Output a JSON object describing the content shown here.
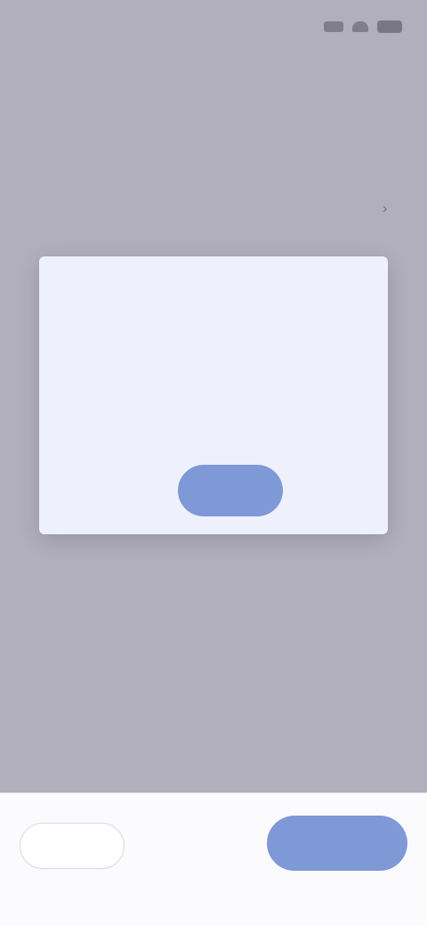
{
  "status_bar": {
    "time": "",
    "icons": [
      "signal-icon",
      "wifi-icon",
      "battery-icon"
    ]
  },
  "header": {
    "title": "",
    "subtitle": ""
  },
  "section": {
    "title": "",
    "row_left": "",
    "row_right": "",
    "row_chevron": "›"
  },
  "dialog": {
    "title": "",
    "body": "",
    "cancel_label": "",
    "confirm_label": ""
  },
  "bottom_bar": {
    "secondary_label": "",
    "primary_label": ""
  },
  "colors": {
    "accent": "#7f98d6",
    "dialog_title": "#3b3a7a",
    "scrim": "#78768a"
  }
}
